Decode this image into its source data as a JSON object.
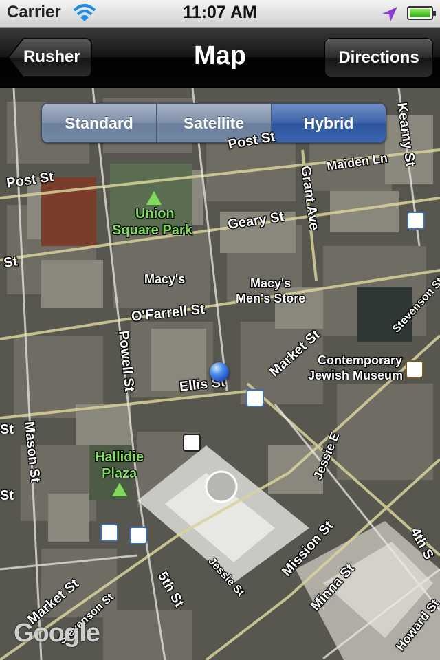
{
  "status_bar": {
    "carrier": "Carrier",
    "time": "11:07 AM"
  },
  "nav_bar": {
    "title": "Map",
    "back_label": "Rusher",
    "directions_label": "Directions"
  },
  "map_type_control": {
    "options": [
      "Standard",
      "Satellite",
      "Hybrid"
    ],
    "selected": "Hybrid"
  },
  "map": {
    "labels": {
      "post_st_top": "Post St",
      "post_st_left": "Post St",
      "maiden_ln": "Maiden Ln",
      "grant_ave": "Grant Ave",
      "kearny_st": "Kearny St",
      "geary_st": "Geary St",
      "union_square_park_1": "Union",
      "union_square_park_2": "Square Park",
      "st_left": "St",
      "macys": "Macy's",
      "macys_mens_1": "Macy's",
      "macys_mens_2": "Men's Store",
      "ofarrell_st": "O'Farrell St",
      "market_st_upper": "Market St",
      "stevenson_st_upper": "Stevenson St",
      "contemporary_1": "Contemporary",
      "contemporary_2": "Jewish Museum",
      "powell_st": "Powell St",
      "ellis_st": "Ellis St",
      "mason_st": "Mason St",
      "hallidie_1": "Hallidie",
      "hallidie_2": "Plaza",
      "jessie_e": "Jessie E",
      "mission_st": "Mission St",
      "jessie_st": "Jessie St",
      "fifth_st": "5th St",
      "minna_st": "Minna St",
      "fourth_st": "4th S",
      "market_st_lower": "Market St",
      "stevenson_st_lower": "Stevenson St",
      "howard_st": "Howard St",
      "st_left2": "St",
      "st_left3": "St"
    },
    "attribution": "Google"
  }
}
